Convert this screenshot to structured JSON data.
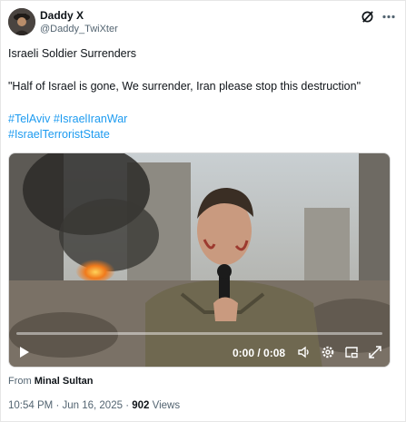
{
  "author": {
    "name": "Daddy X",
    "handle": "@Daddy_TwiXter"
  },
  "post": {
    "line1": "Israeli Soldier Surrenders",
    "line2": "\"Half of Israel is gone, We surrender, Iran please stop this destruction\"",
    "hashtags_line1": [
      "#TelAviv",
      "#IsraelIranWar"
    ],
    "hashtags_line2": [
      "#IsraelTerroristState"
    ]
  },
  "video": {
    "time_display": "0:00 / 0:08",
    "progress": 0.0
  },
  "attribution": {
    "prefix": "From",
    "source": "Minal Sultan"
  },
  "meta": {
    "time": "10:54 PM",
    "separator": "·",
    "date": "Jun 16, 2025",
    "views_count": "902",
    "views_label": "Views"
  },
  "icons": [
    "grok-icon",
    "more-icon",
    "play-icon",
    "volume-icon",
    "settings-icon",
    "pip-icon",
    "fullscreen-icon"
  ],
  "colors": {
    "link": "#1d9bf0",
    "text": "#0f1419",
    "muted": "#536471"
  }
}
